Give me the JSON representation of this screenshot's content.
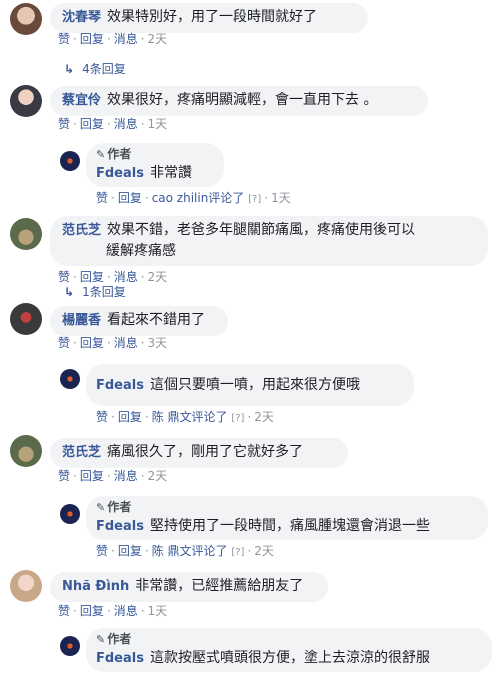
{
  "actions": {
    "like": "赞",
    "reply": "回复",
    "message": "消息"
  },
  "author_tag": "作者",
  "comments": [
    {
      "name": "沈春琴",
      "text": "效果特別好，用了一段時間就好了",
      "time": "2天",
      "replies": "4条回复"
    },
    {
      "name": "蔡宜伶",
      "text": "效果很好，疼痛明顯減輕，會一直用下去 。",
      "time": "1天",
      "reply": {
        "name": "Fdeals",
        "text": "非常讚",
        "meta": "cao zhilin评论了",
        "q": "[?]",
        "time": "1天"
      }
    },
    {
      "name": "范氏芝",
      "text_line1": "效果不錯，老爸多年腿關節痛風，疼痛使用後可以",
      "text_line2": "緩解疼痛感",
      "time": "2天",
      "replies": "1条回复"
    },
    {
      "name": "楊麗香",
      "text": "看起來不錯用了",
      "time": "3天",
      "reply": {
        "name": "Fdeals",
        "text": "這個只要噴一噴，用起來很方便哦",
        "meta": "陈 鼎文评论了",
        "q": "[?]",
        "time": "2天"
      }
    },
    {
      "name": "范氏芝",
      "text": "痛風很久了，剛用了它就好多了",
      "time": "2天",
      "reply": {
        "name": "Fdeals",
        "text": "堅持使用了一段時間，痛風腫塊還會消退一些",
        "meta": "陈 鼎文评论了",
        "q": "[?]",
        "time": "2天"
      }
    },
    {
      "name": "Nhã Đình",
      "text": "非常讚，已經推薦給朋友了",
      "time": "1天",
      "reply": {
        "name": "Fdeals",
        "text": "這款按壓式噴頭很方便，塗上去涼涼的很舒服"
      }
    }
  ]
}
